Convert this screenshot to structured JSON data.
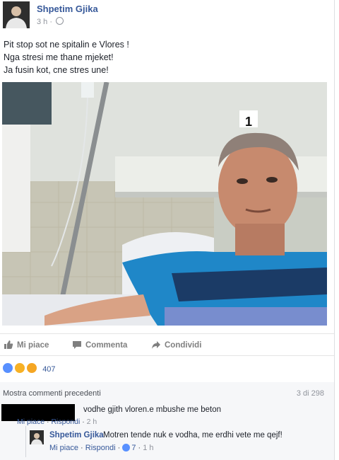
{
  "post": {
    "author": "Shpetim Gjika",
    "time": "3 h",
    "privacy_icon": "globe-icon",
    "lines": [
      "Pit stop sot ne spitalin e Vlores !",
      "Nga stresi me thane mjeket!",
      "Ja fusin kot, cne stres une!"
    ]
  },
  "photo": {
    "room_number": "1"
  },
  "actions": {
    "like": "Mi piace",
    "comment": "Commenta",
    "share": "Condividi"
  },
  "reactions": {
    "count": "407"
  },
  "comments": {
    "show_previous": "Mostra commenti precedenti",
    "count": "3 di 298",
    "items": [
      {
        "text": "vodhe gjith vloren.e mbushe me beton",
        "like": "Mi piace",
        "reply": "Rispondi",
        "time": "2 h"
      },
      {
        "author": "Shpetim Gjika",
        "text": "Motren tende nuk e vodha, me erdhi vete me qejf!",
        "like": "Mi piace",
        "reply": "Rispondi",
        "likes": "7",
        "time": "1 h"
      }
    ]
  },
  "colors": {
    "link": "#365899",
    "meta": "#90949c",
    "like_blue": "#5890ff",
    "shirt": "#1f87c8"
  }
}
